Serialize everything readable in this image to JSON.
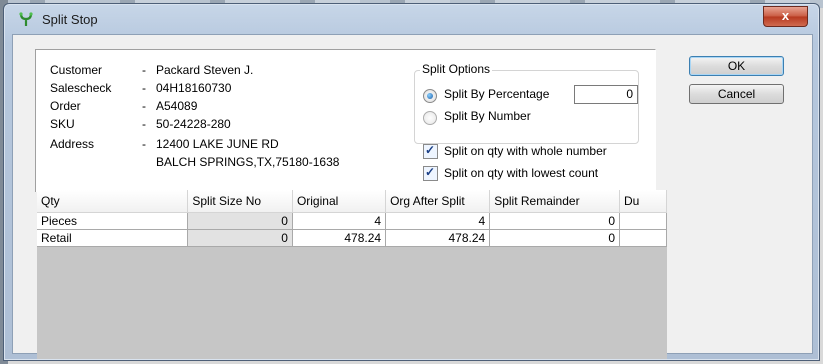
{
  "window": {
    "title": "Split Stop",
    "close_glyph": "x"
  },
  "info": {
    "customer_label": "Customer",
    "customer_value": "Packard Steven J.",
    "salescheck_label": "Salescheck",
    "salescheck_value": "04H18160730",
    "order_label": "Order",
    "order_value": "A54089",
    "sku_label": "SKU",
    "sku_value": "50-24228-280",
    "address_label": "Address",
    "address_line1": "12400 LAKE JUNE RD",
    "address_line2": "BALCH SPRINGS,TX,75180-1638",
    "dash": "-"
  },
  "split_options": {
    "legend": "Split Options",
    "by_percentage_label": "Split By Percentage",
    "by_percentage_selected": true,
    "by_number_label": "Split By Number",
    "percentage_value": "0"
  },
  "checkboxes": {
    "whole_number_label": "Split on qty with whole number",
    "whole_number_checked": true,
    "lowest_count_label": "Split on qty with lowest count",
    "lowest_count_checked": true
  },
  "buttons": {
    "ok": "OK",
    "cancel": "Cancel"
  },
  "grid": {
    "columns": [
      "Qty",
      "Split Size No",
      "Original",
      "Org After Split",
      "Split Remainder",
      "Du"
    ],
    "rows": [
      {
        "qty": "Pieces",
        "split_size_no": "0",
        "original": "4",
        "org_after_split": "4",
        "split_remainder": "0",
        "du": ""
      },
      {
        "qty": "Retail",
        "split_size_no": "0",
        "original": "478.24",
        "org_after_split": "478.24",
        "split_remainder": "0",
        "du": ""
      }
    ]
  },
  "colors": {
    "title_bar": "#b6c8de",
    "close_button": "#c95a42",
    "grid_empty": "#c6c6c6"
  },
  "icons": {
    "app": "app-icon",
    "close": "close-icon"
  }
}
